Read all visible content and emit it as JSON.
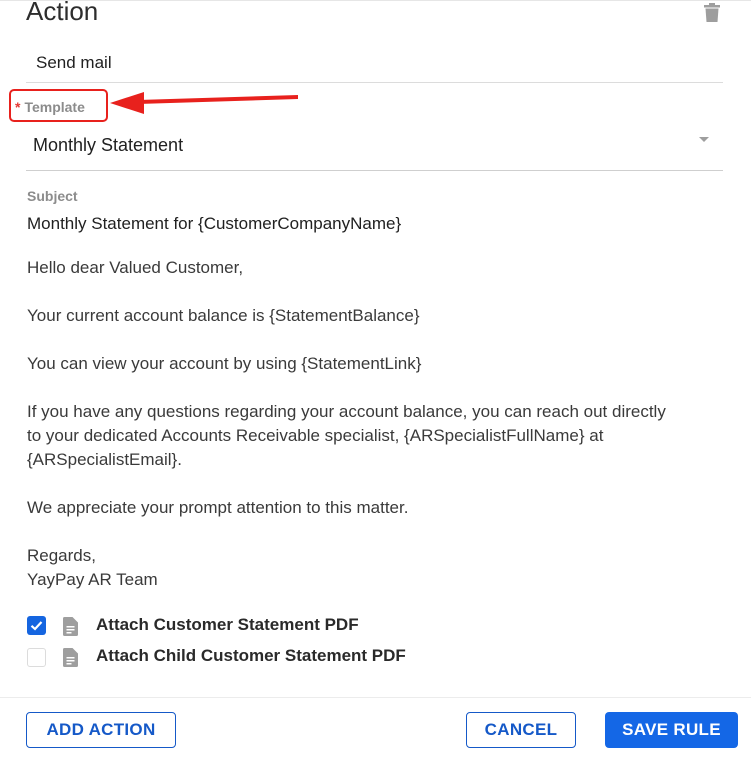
{
  "section": {
    "title": "Action",
    "delete_icon": "trash-icon"
  },
  "action": {
    "value": "Send mail"
  },
  "template": {
    "required_mark": "*",
    "label": "Template",
    "value": "Monthly Statement"
  },
  "subject": {
    "label": "Subject",
    "value": "Monthly Statement for {CustomerCompanyName}"
  },
  "body": {
    "greeting": "Hello dear Valued Customer,",
    "balance": "Your current account balance is {StatementBalance}",
    "view": "You can view your account by using {StatementLink}",
    "questions_line1": "If you have any questions regarding your account balance, you can reach out directly",
    "questions_line2": "to your dedicated Accounts Receivable specialist, {ARSpecialistFullName} at",
    "questions_line3": "{ARSpecialistEmail}.",
    "appreciate": "We appreciate your prompt attention to this matter.",
    "regards": "Regards,",
    "signature": "YayPay AR Team"
  },
  "attachments": [
    {
      "label": "Attach Customer Statement PDF",
      "checked": true,
      "icon": "document-icon"
    },
    {
      "label": "Attach Child Customer Statement PDF",
      "checked": false,
      "icon": "document-icon"
    }
  ],
  "footer": {
    "add_action": "ADD ACTION",
    "cancel": "CANCEL",
    "save_rule": "SAVE RULE"
  },
  "colors": {
    "primary": "#1467e6",
    "highlight": "#e8211d"
  }
}
